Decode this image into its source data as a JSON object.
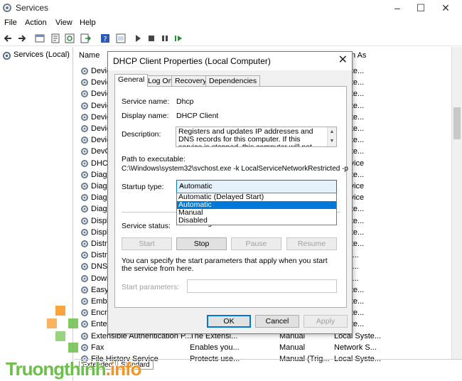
{
  "window": {
    "title": "Services"
  },
  "menu": [
    "File",
    "Action",
    "View",
    "Help"
  ],
  "tree": {
    "root": "Services (Local)"
  },
  "list": {
    "headers": {
      "name": "Name",
      "log_on_as": "n As"
    },
    "rows": [
      {
        "name": "Device",
        "c1": "",
        "c2": "",
        "c3": "l Syste..."
      },
      {
        "name": "Device",
        "c1": "",
        "c2": "",
        "c3": "l Syste..."
      },
      {
        "name": "Device",
        "c1": "",
        "c2": "",
        "c3": "l Syste..."
      },
      {
        "name": "Device",
        "c1": "",
        "c2": "",
        "c3": "l Syste..."
      },
      {
        "name": "Device",
        "c1": "",
        "c2": "",
        "c3": "l Syste..."
      },
      {
        "name": "Device",
        "c1": "",
        "c2": "",
        "c3": "l Syste..."
      },
      {
        "name": "Device",
        "c1": "",
        "c2": "",
        "c3": "l Syste..."
      },
      {
        "name": "DevQu",
        "c1": "",
        "c2": "",
        "c3": "l Syste..."
      },
      {
        "name": "DHCP",
        "c1": "",
        "c2": "",
        "c3": "l Service"
      },
      {
        "name": "Diagn",
        "c1": "",
        "c2": "",
        "c3": "l Syste..."
      },
      {
        "name": "Diagn",
        "c1": "",
        "c2": "",
        "c3": "l Service"
      },
      {
        "name": "Diagn",
        "c1": "",
        "c2": "",
        "c3": "l Service"
      },
      {
        "name": "Diagn",
        "c1": "",
        "c2": "",
        "c3": "l Syste..."
      },
      {
        "name": "Displa",
        "c1": "",
        "c2": "",
        "c3": "l Syste..."
      },
      {
        "name": "Displa",
        "c1": "",
        "c2": "",
        "c3": "l Syste..."
      },
      {
        "name": "Distrib",
        "c1": "",
        "c2": "",
        "c3": "l Syste..."
      },
      {
        "name": "Distrib",
        "c1": "",
        "c2": "",
        "c3": "ork S..."
      },
      {
        "name": "DNS C",
        "c1": "",
        "c2": "",
        "c3": "ork S..."
      },
      {
        "name": "Down",
        "c1": "",
        "c2": "",
        "c3": "ork S..."
      },
      {
        "name": "EasyA",
        "c1": "",
        "c2": "",
        "c3": "l Syste..."
      },
      {
        "name": "Embed",
        "c1": "",
        "c2": "",
        "c3": "l Syste..."
      },
      {
        "name": "Encryp",
        "c1": "",
        "c2": "",
        "c3": "l Syste..."
      },
      {
        "name": "Enterp",
        "c1": "",
        "c2": "",
        "c3": "l Syste..."
      },
      {
        "name": "Extensible Authentication P...",
        "c1": "The Extensi...",
        "c2": "Manual",
        "c3": "Local Syste..."
      },
      {
        "name": "Fax",
        "c1": "Enables you...",
        "c2": "Manual",
        "c3": "Network S..."
      },
      {
        "name": "File History Service",
        "c1": "Protects use...",
        "c2": "Manual (Trig...",
        "c3": "Local Syste..."
      }
    ]
  },
  "bottom_tabs": [
    "Extended",
    "Standard"
  ],
  "dialog": {
    "title": "DHCP Client Properties (Local Computer)",
    "tabs": [
      "General",
      "Log On",
      "Recovery",
      "Dependencies"
    ],
    "service_name_label": "Service name:",
    "service_name": "Dhcp",
    "display_name_label": "Display name:",
    "display_name": "DHCP Client",
    "description_label": "Description:",
    "description": "Registers and updates IP addresses and DNS records for this computer. If this service is stopped, this computer will not receive dynamic IP addresses",
    "path_label": "Path to executable:",
    "path": "C:\\Windows\\system32\\svchost.exe -k LocalServiceNetworkRestricted -p",
    "startup_type_label": "Startup type:",
    "startup_type": "Automatic",
    "startup_options": [
      "Automatic (Delayed Start)",
      "Automatic",
      "Manual",
      "Disabled"
    ],
    "service_status_label": "Service status:",
    "service_status": "Running",
    "buttons": {
      "start": "Start",
      "stop": "Stop",
      "pause": "Pause",
      "resume": "Resume"
    },
    "hint": "You can specify the start parameters that apply when you start the service from here.",
    "start_params_label": "Start parameters:",
    "start_params_value": "",
    "ok": "OK",
    "cancel": "Cancel",
    "apply": "Apply"
  },
  "watermark": {
    "text_a": "Truongthinh",
    "text_b": ".info",
    "color_a": "#6cc04a",
    "color_b": "#f7941d"
  }
}
